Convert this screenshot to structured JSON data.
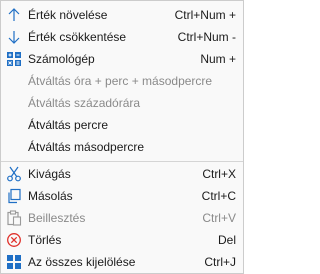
{
  "menu": {
    "items": [
      {
        "label": "Érték növelése",
        "shortcut": "Ctrl+Num +",
        "icon": "arrow-up-icon",
        "enabled": true
      },
      {
        "label": "Érték csökkentése",
        "shortcut": "Ctrl+Num -",
        "icon": "arrow-down-icon",
        "enabled": true
      },
      {
        "label": "Számológép",
        "shortcut": "Num +",
        "icon": "calculator-icon",
        "enabled": true
      },
      {
        "label": "Átváltás óra + perc + másodpercre",
        "shortcut": "",
        "icon": "",
        "enabled": false
      },
      {
        "label": "Átváltás századórára",
        "shortcut": "",
        "icon": "",
        "enabled": false
      },
      {
        "label": "Átváltás percre",
        "shortcut": "",
        "icon": "",
        "enabled": true
      },
      {
        "label": "Átváltás másodpercre",
        "shortcut": "",
        "icon": "",
        "enabled": true
      },
      {
        "label": "Kivágás",
        "shortcut": "Ctrl+X",
        "icon": "scissors-icon",
        "enabled": true
      },
      {
        "label": "Másolás",
        "shortcut": "Ctrl+C",
        "icon": "copy-icon",
        "enabled": true
      },
      {
        "label": "Beillesztés",
        "shortcut": "Ctrl+V",
        "icon": "paste-icon",
        "enabled": false
      },
      {
        "label": "Törlés",
        "shortcut": "Del",
        "icon": "delete-icon",
        "enabled": true
      },
      {
        "label": "Az összes kijelölése",
        "shortcut": "Ctrl+J",
        "icon": "select-all-icon",
        "enabled": true
      }
    ]
  },
  "colors": {
    "accent": "#1f6fc5",
    "delete": "#e0312b",
    "disabled_text": "#8a8a8a"
  }
}
